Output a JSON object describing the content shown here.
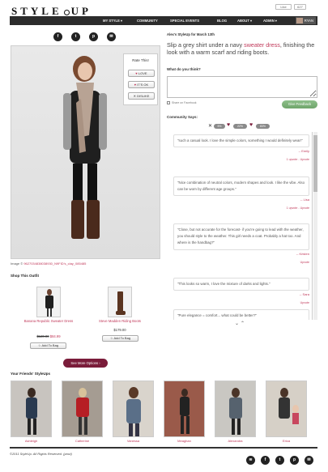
{
  "brand": {
    "logo_left": "STYLE",
    "logo_right": "UP"
  },
  "top_widgets": {
    "like": "Like",
    "count": "627"
  },
  "nav": {
    "items": [
      "MY STYLE",
      "COMMUNITY",
      "SPECIAL EVENTS",
      "BLOG",
      "ABOUT",
      "ADMIN"
    ],
    "user": "RYAN"
  },
  "share_icons": [
    "facebook-icon",
    "twitter-icon",
    "pinterest-icon",
    "email-icon"
  ],
  "photo": {
    "rate": {
      "title": "Rate This!",
      "love": "LOVE",
      "ok": "IT'S OK",
      "dislike": "DISLIKE"
    },
    "caption_prefix": "Image ©",
    "caption_link": "9627034838038930_N9FID's_clay_085485"
  },
  "shop": {
    "title": "Shop This Outfit",
    "items": [
      {
        "name": "Banana Republic Sweater Dress",
        "old_price": "$120.00",
        "price": "$84.99",
        "button": "Add To Bag"
      },
      {
        "name": "Steve Madden Riding Boots",
        "old_price": "",
        "price": "$179.00",
        "button": "Add To Bag"
      }
    ],
    "see_more": "See More Options"
  },
  "friends": {
    "title": "Your Friends' StyleUps",
    "names": [
      "Ashleigh",
      "Catherine",
      "Vanessa",
      "Meaghan",
      "Alexandra",
      "Erica"
    ]
  },
  "footer": {
    "copyright": "©2011 StyleUp. All Rights Reserved.",
    "signature": "(prod)"
  },
  "footer_icons": [
    "rss-icon",
    "facebook-icon",
    "twitter-icon",
    "pinterest-icon",
    "email-icon"
  ],
  "right": {
    "date": "Alex's StyleUp for March 13th",
    "headline_pre": "Slip a grey shirt under a navy ",
    "headline_link": "sweater dress",
    "headline_post": ", finishing the look with a warm scarf and riding boots.",
    "question": "What do you think?",
    "comment_placeholder": "",
    "fb_share": "Share on Facebook",
    "give_feedback": "Give Feedback",
    "community_title": "Community Says:",
    "stats": {
      "dislike": "5%",
      "ok": "22%",
      "love": "83%"
    },
    "comments": [
      {
        "text": "\"such a casual look. I love the simple colors, something I would definitely wear!\"",
        "author": "-- Emily",
        "votes": "1 upvote - Upvote"
      },
      {
        "text": "\"Nice combination of neutral colors, modern shapes and look. I like the vibe. Also can be worn by different age groups.\"",
        "author": "-- Lisa",
        "votes": "1 upvote - Upvote"
      },
      {
        "text": "\"Close, but not accurate for the forecast- if you're going to lead with the weather, you should style to the weather. This girl needs a coat. Probably a hat too. And where is the handbag?\"",
        "author": "-- Kristen",
        "votes": "Upvote"
      },
      {
        "text": "\"This looks so warm, I love the mixture of darks and lights.\"",
        "author": "-- Sara",
        "votes": "Upvote"
      },
      {
        "text": "\"Pure elegance = comfort... what could be better?\"",
        "author": "",
        "votes": ""
      }
    ]
  },
  "colors": {
    "accent": "#c0395a",
    "nav_bg": "#2c2c2c",
    "button_maroon": "#7a1c3a",
    "feedback_green": "#78ae74"
  }
}
